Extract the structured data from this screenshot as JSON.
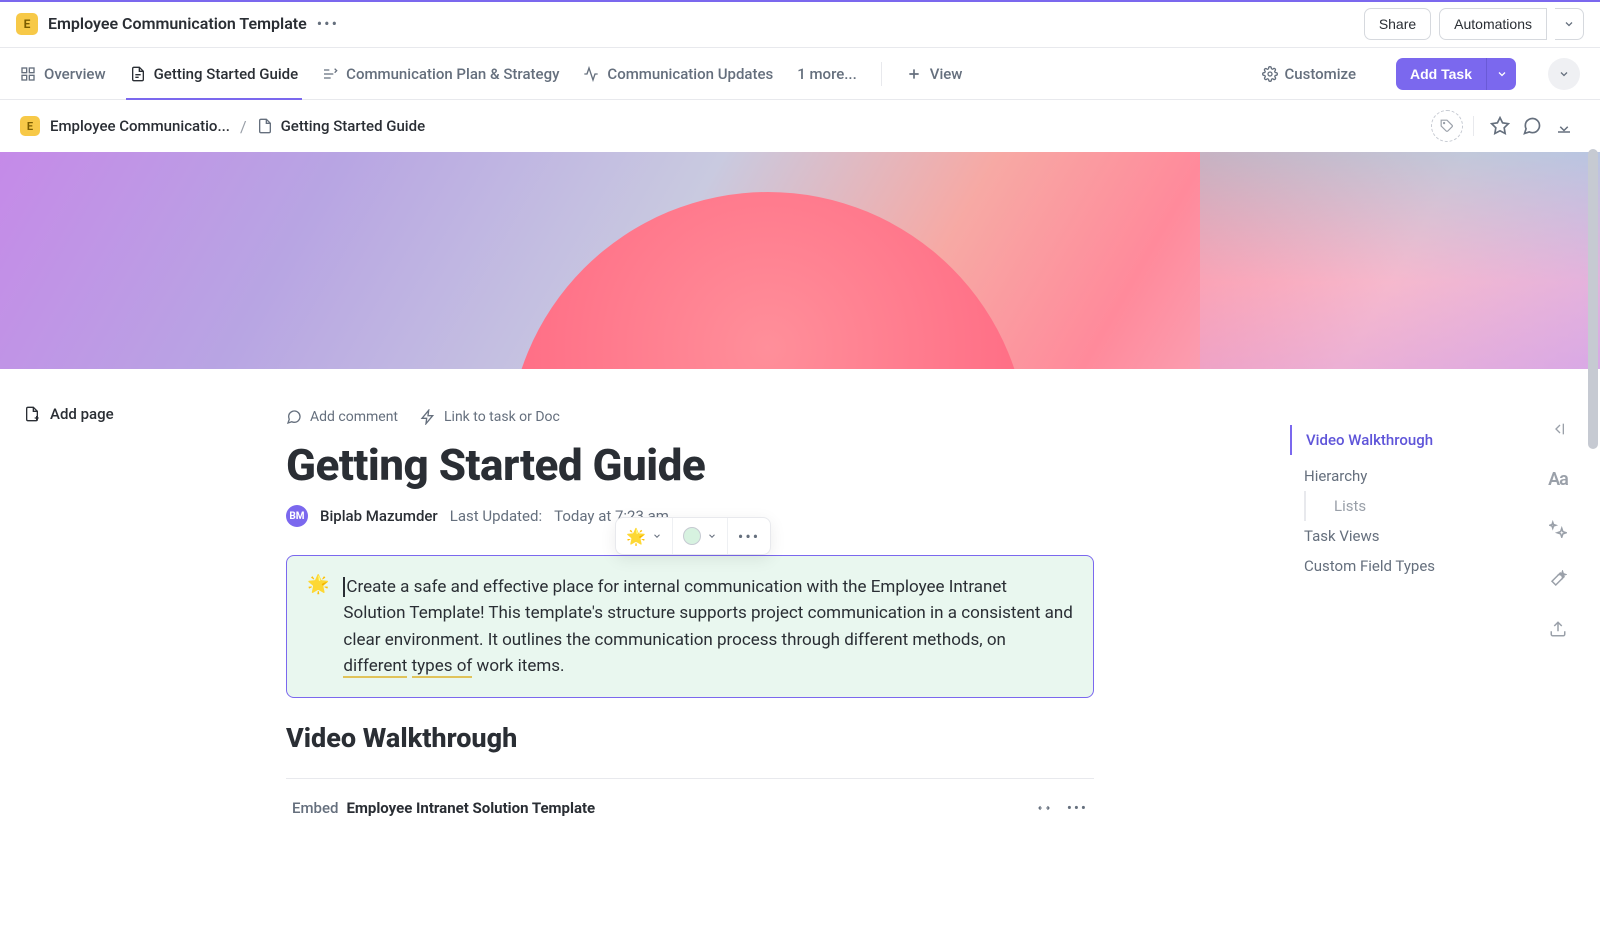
{
  "workspace": {
    "badge": "E",
    "title": "Employee Communication Template"
  },
  "topbar": {
    "share": "Share",
    "automations": "Automations"
  },
  "tabs": {
    "overview": "Overview",
    "guide": "Getting Started Guide",
    "plan": "Communication Plan & Strategy",
    "updates": "Communication Updates",
    "more": "1 more...",
    "view": "View",
    "customize": "Customize",
    "addtask": "Add Task"
  },
  "crumbs": {
    "root": "Employee Communicatio...",
    "current": "Getting Started Guide"
  },
  "left": {
    "addpage": "Add page"
  },
  "doc": {
    "actions": {
      "comment": "Add comment",
      "link": "Link to task or Doc"
    },
    "title": "Getting Started Guide",
    "author_initials": "BM",
    "author": "Biplab Mazumder",
    "updated_label": "Last Updated:",
    "updated_value": "Today at 7:23 am",
    "callout_emoji": "🌟",
    "callout_pre": "Create a safe and effective place for internal communication with the Employee Intranet Solution Template! This template's structure supports project communication in a consistent and clear environment. It outlines the communication process through different methods, on ",
    "callout_sp1": "different",
    "callout_sp2": "types of",
    "callout_post": " work items.",
    "h2": "Video Walkthrough",
    "embed_label": "Embed",
    "embed_name": "Employee Intranet Solution Template",
    "float_emoji": "🌟"
  },
  "outline": {
    "i1": "Video Walkthrough",
    "i2": "Hierarchy",
    "i3": "Lists",
    "i4": "Task Views",
    "i5": "Custom Field Types"
  },
  "rt_tools": {
    "aa": "Aa"
  }
}
